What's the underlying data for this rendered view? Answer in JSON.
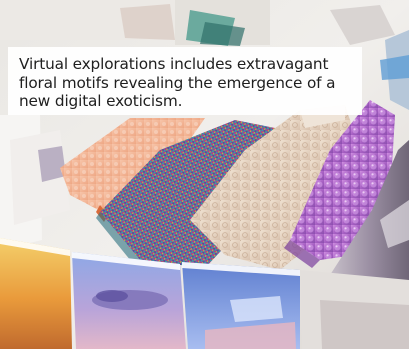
{
  "caption": {
    "text": "Virtual explorations includes extravagant floral motifs revealing the emergence of a new digital exoticism."
  },
  "photo": {
    "subject": "textile-swatches-and-prints",
    "colors": {
      "peach_fabric": "#f2b79a",
      "woven_teal": "#3a9aa6",
      "woven_magenta": "#b23b86",
      "lace_cream": "#e8d6c4",
      "iridescent_purple": "#b274c8",
      "print_blue": "#6f8fd1",
      "print_orange": "#e59a3c"
    }
  }
}
